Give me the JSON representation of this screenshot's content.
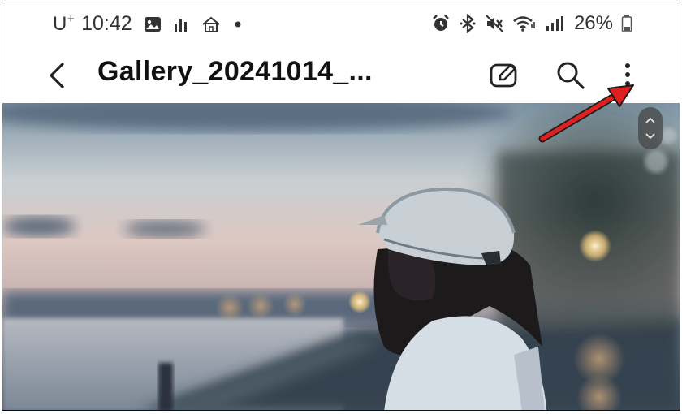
{
  "status_bar": {
    "carrier": "U",
    "carrier_sup": "+",
    "time": "10:42",
    "battery_percent": "26%",
    "icons_left": [
      "gallery-icon",
      "bar-chart-icon",
      "home-icon",
      "dot-icon"
    ],
    "icons_right": [
      "alarm-icon",
      "bluetooth-icon",
      "mute-icon",
      "wifi-icon",
      "signal-icon",
      "battery-icon"
    ]
  },
  "toolbar": {
    "title": "Gallery_20241014_...",
    "back_icon": "back-arrow-icon",
    "edit_icon": "edit-icon",
    "search_icon": "search-icon",
    "more_icon": "more-options-icon"
  },
  "photo": {
    "scroll_handle_icon": "scroll-handle-icon"
  },
  "annotation": {
    "color": "#e02020"
  }
}
